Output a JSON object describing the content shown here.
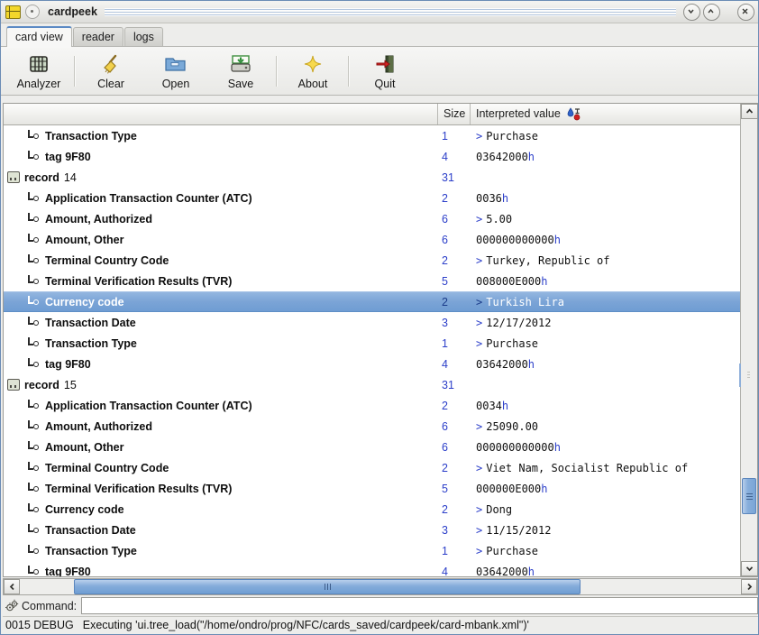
{
  "window": {
    "title": "cardpeek",
    "icons": [
      "smartcard-chip-icon",
      "disc-icon"
    ],
    "buttons": [
      {
        "name": "minimize-button",
        "glyph": "chevron-down-icon"
      },
      {
        "name": "maximize-button",
        "glyph": "chevron-up-icon"
      },
      {
        "name": "close-button",
        "glyph": "close-icon"
      }
    ]
  },
  "tabs": [
    {
      "label": "card view",
      "active": true
    },
    {
      "label": "reader",
      "active": false
    },
    {
      "label": "logs",
      "active": false
    }
  ],
  "toolbar": {
    "items": [
      {
        "label": "Analyzer",
        "icon": "analyzer-icon"
      },
      {
        "label": "Clear",
        "icon": "broom-icon"
      },
      {
        "label": "Open",
        "icon": "folder-open-icon"
      },
      {
        "label": "Save",
        "icon": "save-disk-icon"
      },
      {
        "label": "About",
        "icon": "star-icon"
      },
      {
        "label": "Quit",
        "icon": "exit-door-icon"
      }
    ]
  },
  "tree": {
    "columns": {
      "name": "",
      "size": "Size",
      "value": "Interpreted value",
      "value_icon": "filter-marker-icon"
    },
    "rows": [
      {
        "kind": "leaf",
        "label": "Transaction Type",
        "size": "1",
        "prefix": ">",
        "value": "Purchase",
        "selected": false
      },
      {
        "kind": "leaf",
        "label": "tag 9F80",
        "size": "4",
        "prefix": "",
        "value": "03642000",
        "hex": true,
        "selected": false
      },
      {
        "kind": "record",
        "label": "record",
        "number": "14",
        "size": "31",
        "prefix": "",
        "value": "",
        "selected": false
      },
      {
        "kind": "leaf",
        "label": "Application Transaction Counter (ATC)",
        "size": "2",
        "prefix": "",
        "value": "0036",
        "hex": true,
        "selected": false
      },
      {
        "kind": "leaf",
        "label": "Amount, Authorized",
        "size": "6",
        "prefix": ">",
        "value": "5.00",
        "selected": false
      },
      {
        "kind": "leaf",
        "label": "Amount, Other",
        "size": "6",
        "prefix": "",
        "value": "000000000000",
        "hex": true,
        "selected": false
      },
      {
        "kind": "leaf",
        "label": "Terminal Country Code",
        "size": "2",
        "prefix": ">",
        "value": "Turkey, Republic of",
        "selected": false
      },
      {
        "kind": "leaf",
        "label": "Terminal Verification Results (TVR)",
        "size": "5",
        "prefix": "",
        "value": "008000E000",
        "hex": true,
        "selected": false
      },
      {
        "kind": "leaf",
        "label": "Currency code",
        "size": "2",
        "prefix": ">",
        "value": "Turkish Lira",
        "selected": true
      },
      {
        "kind": "leaf",
        "label": "Transaction Date",
        "size": "3",
        "prefix": ">",
        "value": "12/17/2012",
        "selected": false
      },
      {
        "kind": "leaf",
        "label": "Transaction Type",
        "size": "1",
        "prefix": ">",
        "value": "Purchase",
        "selected": false
      },
      {
        "kind": "leaf",
        "label": "tag 9F80",
        "size": "4",
        "prefix": "",
        "value": "03642000",
        "hex": true,
        "selected": false
      },
      {
        "kind": "record",
        "label": "record",
        "number": "15",
        "size": "31",
        "prefix": "",
        "value": "",
        "selected": false
      },
      {
        "kind": "leaf",
        "label": "Application Transaction Counter (ATC)",
        "size": "2",
        "prefix": "",
        "value": "0034",
        "hex": true,
        "selected": false
      },
      {
        "kind": "leaf",
        "label": "Amount, Authorized",
        "size": "6",
        "prefix": ">",
        "value": "25090.00",
        "selected": false
      },
      {
        "kind": "leaf",
        "label": "Amount, Other",
        "size": "6",
        "prefix": "",
        "value": "000000000000",
        "hex": true,
        "selected": false
      },
      {
        "kind": "leaf",
        "label": "Terminal Country Code",
        "size": "2",
        "prefix": ">",
        "value": "Viet Nam, Socialist Republic of",
        "selected": false
      },
      {
        "kind": "leaf",
        "label": "Terminal Verification Results (TVR)",
        "size": "5",
        "prefix": "",
        "value": "000000E000",
        "hex": true,
        "selected": false
      },
      {
        "kind": "leaf",
        "label": "Currency code",
        "size": "2",
        "prefix": ">",
        "value": "Dong",
        "selected": false
      },
      {
        "kind": "leaf",
        "label": "Transaction Date",
        "size": "3",
        "prefix": ">",
        "value": "11/15/2012",
        "selected": false
      },
      {
        "kind": "leaf",
        "label": "Transaction Type",
        "size": "1",
        "prefix": ">",
        "value": "Purchase",
        "selected": false
      },
      {
        "kind": "leaf",
        "label": "tag 9F80",
        "size": "4",
        "prefix": "",
        "value": "03642000",
        "hex": true,
        "selected": false
      }
    ]
  },
  "command": {
    "icon": "gears-icon",
    "label": "Command:",
    "value": "",
    "placeholder": ""
  },
  "status": {
    "code": "0015 DEBUG",
    "message": "Executing 'ui.tree_load(\"/home/ondro/prog/NFC/cards_saved/cardpeek/card-mbank.xml\")'"
  },
  "colors": {
    "selection": "#7ba4d6",
    "blue_text": "#2b3ec9",
    "tab_active_accent": "#5b8ac4"
  }
}
